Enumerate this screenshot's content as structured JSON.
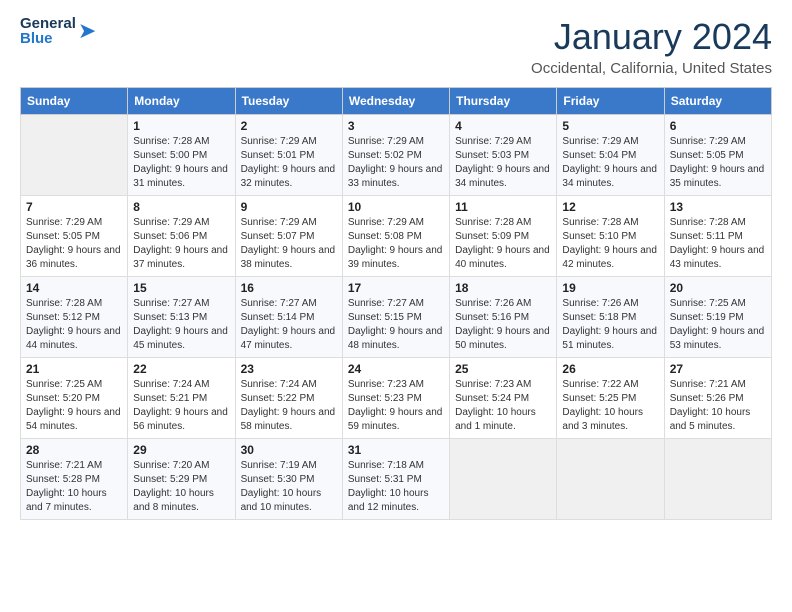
{
  "header": {
    "logo_general": "General",
    "logo_blue": "Blue",
    "month_title": "January 2024",
    "location": "Occidental, California, United States"
  },
  "weekdays": [
    "Sunday",
    "Monday",
    "Tuesday",
    "Wednesday",
    "Thursday",
    "Friday",
    "Saturday"
  ],
  "rows": [
    {
      "cells": [
        {
          "date": "",
          "empty": true
        },
        {
          "date": "1",
          "sunrise": "Sunrise: 7:28 AM",
          "sunset": "Sunset: 5:00 PM",
          "daylight": "Daylight: 9 hours and 31 minutes."
        },
        {
          "date": "2",
          "sunrise": "Sunrise: 7:29 AM",
          "sunset": "Sunset: 5:01 PM",
          "daylight": "Daylight: 9 hours and 32 minutes."
        },
        {
          "date": "3",
          "sunrise": "Sunrise: 7:29 AM",
          "sunset": "Sunset: 5:02 PM",
          "daylight": "Daylight: 9 hours and 33 minutes."
        },
        {
          "date": "4",
          "sunrise": "Sunrise: 7:29 AM",
          "sunset": "Sunset: 5:03 PM",
          "daylight": "Daylight: 9 hours and 34 minutes."
        },
        {
          "date": "5",
          "sunrise": "Sunrise: 7:29 AM",
          "sunset": "Sunset: 5:04 PM",
          "daylight": "Daylight: 9 hours and 34 minutes."
        },
        {
          "date": "6",
          "sunrise": "Sunrise: 7:29 AM",
          "sunset": "Sunset: 5:05 PM",
          "daylight": "Daylight: 9 hours and 35 minutes."
        }
      ]
    },
    {
      "cells": [
        {
          "date": "7",
          "sunrise": "Sunrise: 7:29 AM",
          "sunset": "Sunset: 5:05 PM",
          "daylight": "Daylight: 9 hours and 36 minutes."
        },
        {
          "date": "8",
          "sunrise": "Sunrise: 7:29 AM",
          "sunset": "Sunset: 5:06 PM",
          "daylight": "Daylight: 9 hours and 37 minutes."
        },
        {
          "date": "9",
          "sunrise": "Sunrise: 7:29 AM",
          "sunset": "Sunset: 5:07 PM",
          "daylight": "Daylight: 9 hours and 38 minutes."
        },
        {
          "date": "10",
          "sunrise": "Sunrise: 7:29 AM",
          "sunset": "Sunset: 5:08 PM",
          "daylight": "Daylight: 9 hours and 39 minutes."
        },
        {
          "date": "11",
          "sunrise": "Sunrise: 7:28 AM",
          "sunset": "Sunset: 5:09 PM",
          "daylight": "Daylight: 9 hours and 40 minutes."
        },
        {
          "date": "12",
          "sunrise": "Sunrise: 7:28 AM",
          "sunset": "Sunset: 5:10 PM",
          "daylight": "Daylight: 9 hours and 42 minutes."
        },
        {
          "date": "13",
          "sunrise": "Sunrise: 7:28 AM",
          "sunset": "Sunset: 5:11 PM",
          "daylight": "Daylight: 9 hours and 43 minutes."
        }
      ]
    },
    {
      "cells": [
        {
          "date": "14",
          "sunrise": "Sunrise: 7:28 AM",
          "sunset": "Sunset: 5:12 PM",
          "daylight": "Daylight: 9 hours and 44 minutes."
        },
        {
          "date": "15",
          "sunrise": "Sunrise: 7:27 AM",
          "sunset": "Sunset: 5:13 PM",
          "daylight": "Daylight: 9 hours and 45 minutes."
        },
        {
          "date": "16",
          "sunrise": "Sunrise: 7:27 AM",
          "sunset": "Sunset: 5:14 PM",
          "daylight": "Daylight: 9 hours and 47 minutes."
        },
        {
          "date": "17",
          "sunrise": "Sunrise: 7:27 AM",
          "sunset": "Sunset: 5:15 PM",
          "daylight": "Daylight: 9 hours and 48 minutes."
        },
        {
          "date": "18",
          "sunrise": "Sunrise: 7:26 AM",
          "sunset": "Sunset: 5:16 PM",
          "daylight": "Daylight: 9 hours and 50 minutes."
        },
        {
          "date": "19",
          "sunrise": "Sunrise: 7:26 AM",
          "sunset": "Sunset: 5:18 PM",
          "daylight": "Daylight: 9 hours and 51 minutes."
        },
        {
          "date": "20",
          "sunrise": "Sunrise: 7:25 AM",
          "sunset": "Sunset: 5:19 PM",
          "daylight": "Daylight: 9 hours and 53 minutes."
        }
      ]
    },
    {
      "cells": [
        {
          "date": "21",
          "sunrise": "Sunrise: 7:25 AM",
          "sunset": "Sunset: 5:20 PM",
          "daylight": "Daylight: 9 hours and 54 minutes."
        },
        {
          "date": "22",
          "sunrise": "Sunrise: 7:24 AM",
          "sunset": "Sunset: 5:21 PM",
          "daylight": "Daylight: 9 hours and 56 minutes."
        },
        {
          "date": "23",
          "sunrise": "Sunrise: 7:24 AM",
          "sunset": "Sunset: 5:22 PM",
          "daylight": "Daylight: 9 hours and 58 minutes."
        },
        {
          "date": "24",
          "sunrise": "Sunrise: 7:23 AM",
          "sunset": "Sunset: 5:23 PM",
          "daylight": "Daylight: 9 hours and 59 minutes."
        },
        {
          "date": "25",
          "sunrise": "Sunrise: 7:23 AM",
          "sunset": "Sunset: 5:24 PM",
          "daylight": "Daylight: 10 hours and 1 minute."
        },
        {
          "date": "26",
          "sunrise": "Sunrise: 7:22 AM",
          "sunset": "Sunset: 5:25 PM",
          "daylight": "Daylight: 10 hours and 3 minutes."
        },
        {
          "date": "27",
          "sunrise": "Sunrise: 7:21 AM",
          "sunset": "Sunset: 5:26 PM",
          "daylight": "Daylight: 10 hours and 5 minutes."
        }
      ]
    },
    {
      "cells": [
        {
          "date": "28",
          "sunrise": "Sunrise: 7:21 AM",
          "sunset": "Sunset: 5:28 PM",
          "daylight": "Daylight: 10 hours and 7 minutes."
        },
        {
          "date": "29",
          "sunrise": "Sunrise: 7:20 AM",
          "sunset": "Sunset: 5:29 PM",
          "daylight": "Daylight: 10 hours and 8 minutes."
        },
        {
          "date": "30",
          "sunrise": "Sunrise: 7:19 AM",
          "sunset": "Sunset: 5:30 PM",
          "daylight": "Daylight: 10 hours and 10 minutes."
        },
        {
          "date": "31",
          "sunrise": "Sunrise: 7:18 AM",
          "sunset": "Sunset: 5:31 PM",
          "daylight": "Daylight: 10 hours and 12 minutes."
        },
        {
          "date": "",
          "empty": true
        },
        {
          "date": "",
          "empty": true
        },
        {
          "date": "",
          "empty": true
        }
      ]
    }
  ]
}
